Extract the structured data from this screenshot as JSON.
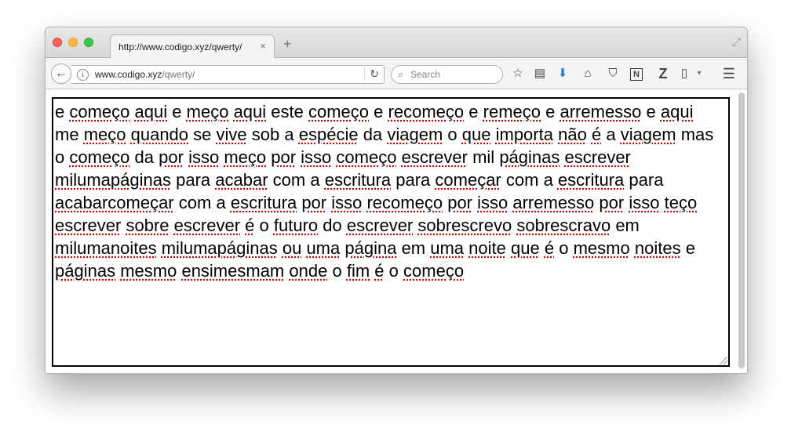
{
  "tab": {
    "title": "http://www.codigo.xyz/qwerty/",
    "close": "×",
    "new_tab": "+"
  },
  "navbar": {
    "back": "←",
    "url_domain": "www.codigo.xyz",
    "url_path": "/qwerty/",
    "reload": "↻",
    "search_placeholder": "Search",
    "search_glyph": "⌕"
  },
  "toolbar_icons": [
    "bookmark-star-icon",
    "reading-list-icon",
    "downloads-icon",
    "home-icon",
    "pocket-icon",
    "onenote-icon",
    "zotero-icon",
    "page-icon",
    "menu-icon"
  ],
  "toolbar_glyphs": {
    "star": "☆",
    "reading": "▤",
    "download": "⬇",
    "home": "⌂",
    "pocket": "⛉",
    "onenote": "N",
    "zotero": "Z",
    "page": "▯",
    "dropdown": "▾",
    "menu": "☰"
  },
  "colors": {
    "download_arrow": "#2a7de1",
    "spell_underline": "#d40000"
  },
  "textarea": {
    "words": [
      "e",
      "começo",
      "aqui",
      "e",
      "meço",
      "aqui",
      "este",
      "começo",
      "e",
      "recomeço",
      "e",
      "remeço",
      "e",
      "arremesso",
      "e",
      "aqui",
      "me",
      "meço",
      "quando",
      "se",
      "vive",
      "sob",
      "a",
      "espécie",
      "da",
      "viagem",
      "o",
      "que",
      "importa",
      "não",
      "é",
      "a",
      "viagem",
      "mas",
      "o",
      "começo",
      "da",
      "por",
      "isso",
      "meço",
      "por",
      "isso",
      "começo",
      "escrever",
      "mil",
      "páginas",
      "escrever",
      "milumapáginas",
      "para",
      "acabar",
      "com",
      "a",
      "escritura",
      "para",
      "começar",
      "com",
      "a",
      "escritura",
      "para",
      "acabarcomeçar",
      "com",
      "a",
      "escritura",
      "por",
      "isso",
      "recomeço",
      "por",
      "isso",
      "arremesso",
      "por",
      "isso",
      "teço",
      "escrever",
      "sobre",
      "escrever",
      "é",
      "o",
      "futuro",
      "do",
      "escrever",
      "sobrescrevo",
      "sobrescravo",
      "em",
      "milumanoites",
      "milumapáginas",
      "ou",
      "uma",
      "página",
      "em",
      "uma",
      "noite",
      "que",
      "é",
      "o",
      "mesmo",
      "noites",
      "e",
      "páginas",
      "mesmo",
      "ensimesmam",
      "onde",
      "o",
      "fim",
      "é",
      "o",
      "começo"
    ],
    "misspelled": [
      "começo",
      "aqui",
      "meço",
      "recomeço",
      "remeço",
      "arremesso",
      "quando",
      "vive",
      "espécie",
      "viagem",
      "importa",
      "não",
      "é",
      "por",
      "isso",
      "escrever",
      "páginas",
      "milumapáginas",
      "acabar",
      "escritura",
      "começar",
      "acabarcomeçar",
      "teço",
      "sobre",
      "futuro",
      "sobrescrevo",
      "sobrescravo",
      "milumanoites",
      "ou",
      "uma",
      "página",
      "noite",
      "que",
      "mesmo",
      "noites",
      "ensimesmam",
      "onde",
      "fim"
    ]
  }
}
